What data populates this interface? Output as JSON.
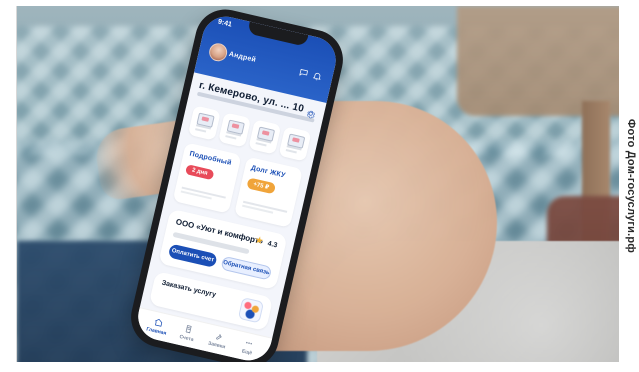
{
  "photo": {
    "credit": "Фото Дом-госуслуги.рф"
  },
  "app": {
    "status": {
      "time": "9:41"
    },
    "header": {
      "user_name": "Андрей"
    },
    "address": {
      "title": "г. Кемерово, ул. ... 10"
    },
    "cards": [
      {
        "title": "Подробный",
        "pill": "2 дня"
      },
      {
        "title": "Долг ЖКУ",
        "pill": "+75 ₽"
      }
    ],
    "promo": {
      "title": "ООО «Уют и комфорт»",
      "rating": "4.3",
      "buttons": [
        {
          "label": "Оплатить счет"
        },
        {
          "label": "Обратная связь"
        }
      ]
    },
    "service": {
      "title": "Заказать услугу"
    },
    "tabs": [
      {
        "label": "Главная"
      },
      {
        "label": "Счета"
      },
      {
        "label": "Заявки"
      },
      {
        "label": "Ещё"
      }
    ]
  },
  "colors": {
    "brand_blue": "#1b4fb6",
    "accent_red": "#e84b5a",
    "accent_orange": "#f0a43a",
    "star_yellow": "#f4b331"
  }
}
